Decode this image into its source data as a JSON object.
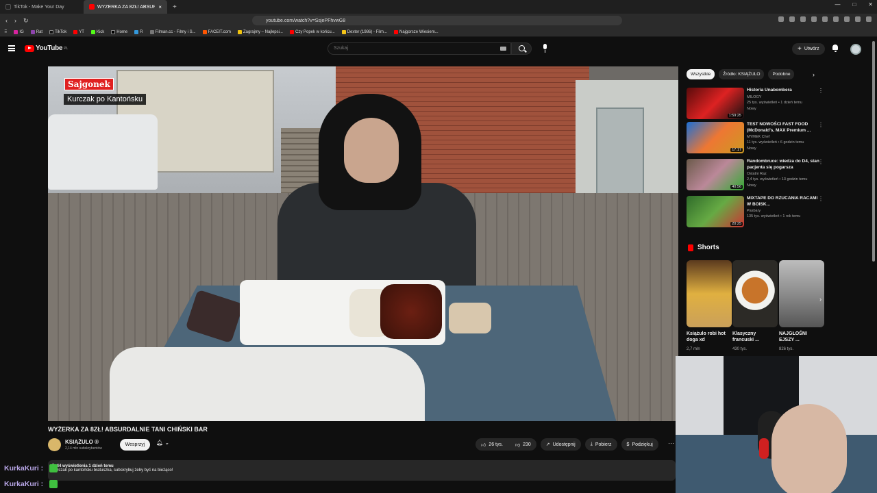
{
  "browser": {
    "tabs": [
      {
        "label": "TikTok - Make Your Day",
        "active": false
      },
      {
        "label": "WYŻERKA ZA 8ZŁ! ABSURD...",
        "active": true
      }
    ],
    "url": "youtube.com/watch?v=SsjePFhvwG8",
    "bookmarks": [
      "IG",
      "Rat",
      "TikTok",
      "YT",
      "Kick",
      "Home",
      "R",
      "Filman.cc - Filmy i S...",
      "FACEIT.com",
      "Zagrajmy – Najlepsi...",
      "Czy Popek w końcu...",
      "Dexter (1986) - Film...",
      "Najgorsze Wiesiem..."
    ]
  },
  "youtube": {
    "logo_text": "YouTube",
    "logo_region": "PL",
    "search_placeholder": "Szukaj",
    "create_label": "Utwórz"
  },
  "video": {
    "overlay_badge": "Sajgonek",
    "overlay_caption": "Kurczak po Kantońsku",
    "title": "WYŻERKA ZA 8ZŁ! ABSURDALNIE TANI CHIŃSKI BAR",
    "channel": "KSIĄŻULO ®",
    "subscribers": "2,14 mln subskrybentów",
    "support_label": "Wesprzyj",
    "likes": "26 tys.",
    "dislikes": "230",
    "share_label": "Udostępnij",
    "download_label": "Pobierz",
    "thanks_label": "Podziękuj",
    "description_meta": "7. 44 wyświetlenia  1 dzień temu",
    "description_text": "Kurczak po kantońsku bratuszka, subskrybuj żeby być na bieżąco!"
  },
  "sidebar": {
    "chips": [
      "Wszystkie",
      "Źródło: KSIĄŻULO",
      "Podobne"
    ],
    "recommendations": [
      {
        "title": "Historia Unabombera",
        "channel": "MILOGY",
        "meta": "25 tys. wyświetleń • 1 dzień temu",
        "badge": "Nowy",
        "duration": "1:59:25"
      },
      {
        "title": "TEST NOWOŚCI FAST FOOD (McDonald's, MAX Premium ...",
        "channel": "MYMEK Chef",
        "meta": "11 tys. wyświetleń • 6 godzin temu",
        "badge": "Nowy",
        "duration": "17:17"
      },
      {
        "title": "Randombruce: wiedza do D4, stan pacjenta się pogarsza",
        "channel": "Ostatni Raz",
        "meta": "2,4 tys. wyświetleń • 13 godzin temu",
        "badge": "Nowy",
        "duration": "40:56"
      },
      {
        "title": "MIXTAPE DO RZUCANIA RACAMI W BOISK...",
        "channel": "Pasbary",
        "meta": "135 tys. wyświetleń • 1 rok temu",
        "badge": "",
        "duration": "20:25"
      }
    ],
    "shorts_heading": "Shorts",
    "shorts": [
      {
        "title": "Książulo robi hot doga xd",
        "views": "2,7 mln"
      },
      {
        "title": "Klasyczny francuski ...",
        "views": "430 tys."
      },
      {
        "title": "NAJGŁOŚNI EJSZY ...",
        "views": "826 tys."
      }
    ]
  },
  "chat": [
    {
      "user": "KurkaKuri :",
      "message": ""
    },
    {
      "user": "KurkaKuri :",
      "message": ""
    }
  ],
  "colors": {
    "brand": "#ff0000",
    "bg": "#0f0f0f",
    "chat_name": "#b9a7e8"
  }
}
